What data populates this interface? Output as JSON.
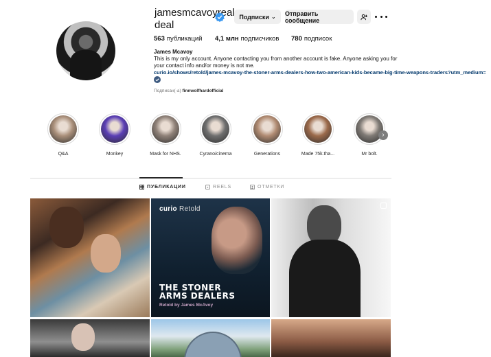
{
  "profile": {
    "username": "jamesmcavoyreal deal",
    "verified": true,
    "follow_button": "Подписки",
    "message_button": "Отправить сообщение",
    "stats": {
      "posts_value": "563",
      "posts_label": "публикаций",
      "followers_value": "4,1 млн",
      "followers_label": "подписчиков",
      "following_value": "780",
      "following_label": "подписок"
    },
    "full_name": "James Mcavoy",
    "bio": "This is my only account. Anyone contacting you from another account is fake. Anyone asking you for your contact info and/or money is not me.",
    "link": "curio.io/shows/retold/james-mcavoy-the-stoner-arms-dealers-how-two-american-kids-became-big-time-weapons-traders?utm_medium=",
    "followed_by_prefix": "Подписан(-а)",
    "followed_by_user": "finnwolfhardofficial"
  },
  "highlights": [
    {
      "label": "Q&A",
      "color": "#a98f7a"
    },
    {
      "label": "Monkey",
      "color": "#5b3fb5"
    },
    {
      "label": "Mask for NHS.",
      "color": "#8f8178"
    },
    {
      "label": "Cyrano/cinema",
      "color": "#6f6f6f"
    },
    {
      "label": "Generations",
      "color": "#b08b72"
    },
    {
      "label": "Made 75k.tha...",
      "color": "#9b6a4b"
    },
    {
      "label": "Mr bolt.",
      "color": "#7f7a75"
    }
  ],
  "tabs": {
    "posts": "ПУБЛИКАЦИИ",
    "reels": "REELS",
    "tagged": "ОТМЕТКИ"
  },
  "posts": {
    "p2_brand": "curio",
    "p2_brand_suffix": "Retold",
    "p2_title_line1": "THE STONER",
    "p2_title_line2": "ARMS DEALERS",
    "p2_subtitle": "Retold by James McAvoy"
  },
  "colors": {
    "verified_blue": "#3897f0",
    "link_blue": "#00376b",
    "button_grey": "#efefef"
  }
}
